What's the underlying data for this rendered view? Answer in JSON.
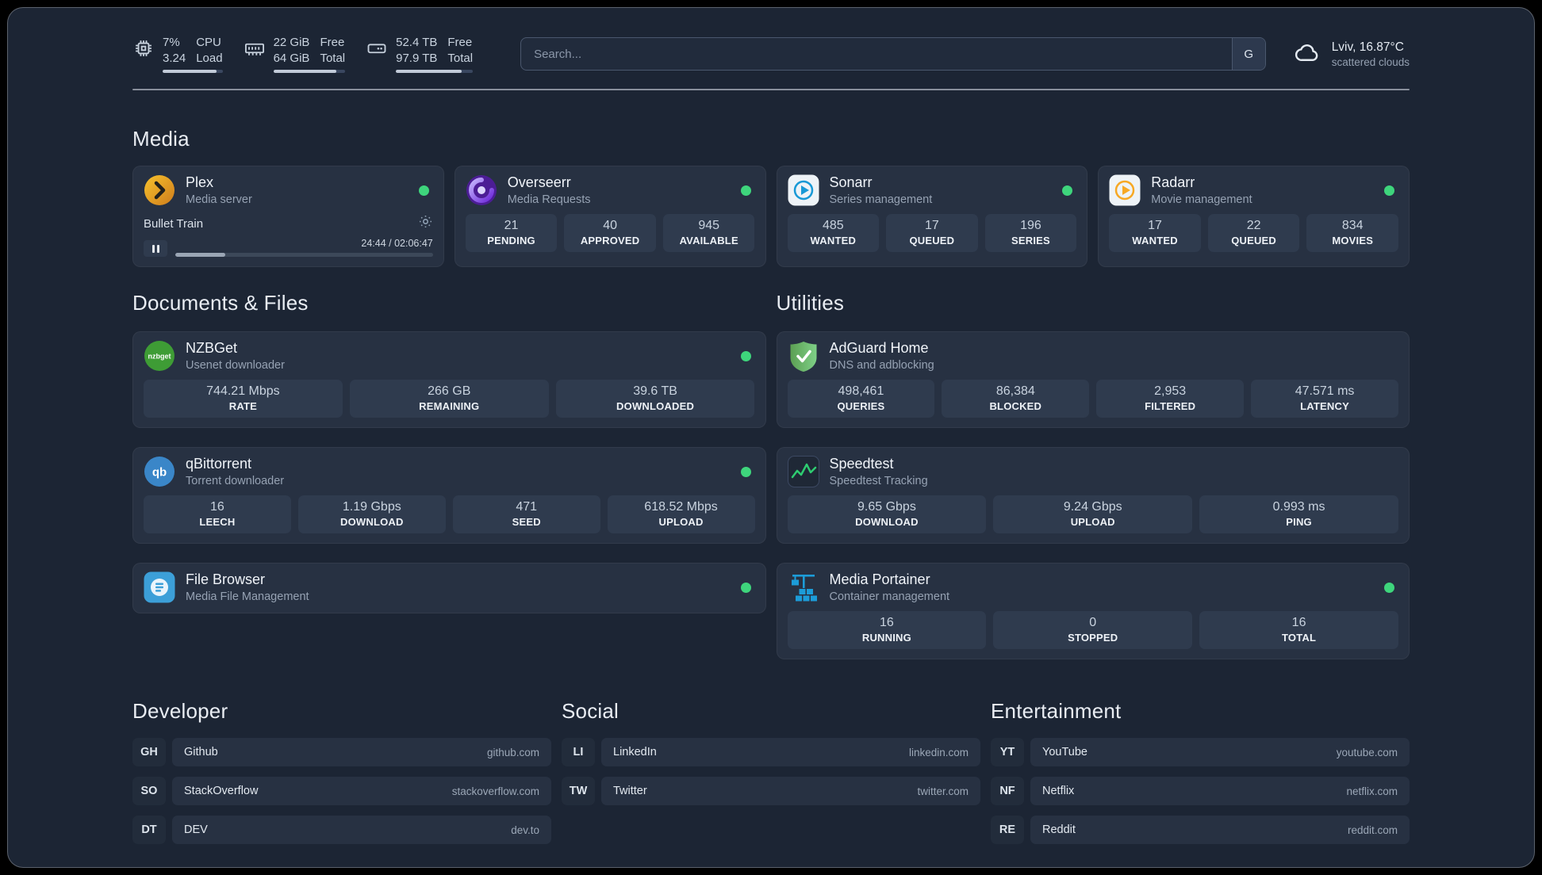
{
  "topbar": {
    "cpu": {
      "value1": "7%",
      "value2": "3.24",
      "label1": "CPU",
      "label2": "Load",
      "bar_percent": 90
    },
    "memory": {
      "value1": "22 GiB",
      "value2": "64 GiB",
      "label1": "Free",
      "label2": "Total",
      "bar_percent": 88
    },
    "disk": {
      "value1": "52.4 TB",
      "value2": "97.9 TB",
      "label1": "Free",
      "label2": "Total",
      "bar_percent": 85
    },
    "search": {
      "placeholder": "Search...",
      "provider_button": "G"
    },
    "weather": {
      "location": "Lviv, 16.87°C",
      "condition": "scattered clouds"
    }
  },
  "colors": {
    "page_background": "#1c2534",
    "card_background": "#273142",
    "status_green": "#3ed57c"
  },
  "sections": {
    "media": {
      "title": "Media",
      "cards": {
        "plex": {
          "name": "Plex",
          "subtitle": "Media server",
          "now_playing": {
            "title": "Bullet Train",
            "time": "24:44 / 02:06:47",
            "progress_percent": 19.5
          }
        },
        "overseerr": {
          "name": "Overseerr",
          "subtitle": "Media Requests",
          "stats": [
            {
              "value": "21",
              "label": "PENDING"
            },
            {
              "value": "40",
              "label": "APPROVED"
            },
            {
              "value": "945",
              "label": "AVAILABLE"
            }
          ]
        },
        "sonarr": {
          "name": "Sonarr",
          "subtitle": "Series management",
          "stats": [
            {
              "value": "485",
              "label": "WANTED"
            },
            {
              "value": "17",
              "label": "QUEUED"
            },
            {
              "value": "196",
              "label": "SERIES"
            }
          ]
        },
        "radarr": {
          "name": "Radarr",
          "subtitle": "Movie management",
          "stats": [
            {
              "value": "17",
              "label": "WANTED"
            },
            {
              "value": "22",
              "label": "QUEUED"
            },
            {
              "value": "834",
              "label": "MOVIES"
            }
          ]
        }
      }
    },
    "documents": {
      "title": "Documents & Files",
      "cards": {
        "nzbget": {
          "name": "NZBGet",
          "subtitle": "Usenet downloader",
          "stats": [
            {
              "value": "744.21 Mbps",
              "label": "RATE"
            },
            {
              "value": "266 GB",
              "label": "REMAINING"
            },
            {
              "value": "39.6 TB",
              "label": "DOWNLOADED"
            }
          ]
        },
        "qbittorrent": {
          "name": "qBittorrent",
          "subtitle": "Torrent downloader",
          "stats": [
            {
              "value": "16",
              "label": "LEECH"
            },
            {
              "value": "1.19 Gbps",
              "label": "DOWNLOAD"
            },
            {
              "value": "471",
              "label": "SEED"
            },
            {
              "value": "618.52 Mbps",
              "label": "UPLOAD"
            }
          ]
        },
        "filebrowser": {
          "name": "File Browser",
          "subtitle": "Media File Management"
        }
      }
    },
    "utilities": {
      "title": "Utilities",
      "cards": {
        "adguard": {
          "name": "AdGuard Home",
          "subtitle": "DNS and adblocking",
          "stats": [
            {
              "value": "498,461",
              "label": "QUERIES"
            },
            {
              "value": "86,384",
              "label": "BLOCKED"
            },
            {
              "value": "2,953",
              "label": "FILTERED"
            },
            {
              "value": "47.571 ms",
              "label": "LATENCY"
            }
          ]
        },
        "speedtest": {
          "name": "Speedtest",
          "subtitle": "Speedtest Tracking",
          "stats": [
            {
              "value": "9.65 Gbps",
              "label": "DOWNLOAD"
            },
            {
              "value": "9.24 Gbps",
              "label": "UPLOAD"
            },
            {
              "value": "0.993 ms",
              "label": "PING"
            }
          ]
        },
        "portainer": {
          "name": "Media Portainer",
          "subtitle": "Container management",
          "stats": [
            {
              "value": "16",
              "label": "RUNNING"
            },
            {
              "value": "0",
              "label": "STOPPED"
            },
            {
              "value": "16",
              "label": "TOTAL"
            }
          ]
        }
      }
    },
    "developer": {
      "title": "Developer",
      "links": [
        {
          "abbr": "GH",
          "name": "Github",
          "domain": "github.com"
        },
        {
          "abbr": "SO",
          "name": "StackOverflow",
          "domain": "stackoverflow.com"
        },
        {
          "abbr": "DT",
          "name": "DEV",
          "domain": "dev.to"
        }
      ]
    },
    "social": {
      "title": "Social",
      "links": [
        {
          "abbr": "LI",
          "name": "LinkedIn",
          "domain": "linkedin.com"
        },
        {
          "abbr": "TW",
          "name": "Twitter",
          "domain": "twitter.com"
        }
      ]
    },
    "entertainment": {
      "title": "Entertainment",
      "links": [
        {
          "abbr": "YT",
          "name": "YouTube",
          "domain": "youtube.com"
        },
        {
          "abbr": "NF",
          "name": "Netflix",
          "domain": "netflix.com"
        },
        {
          "abbr": "RE",
          "name": "Reddit",
          "domain": "reddit.com"
        }
      ]
    }
  }
}
